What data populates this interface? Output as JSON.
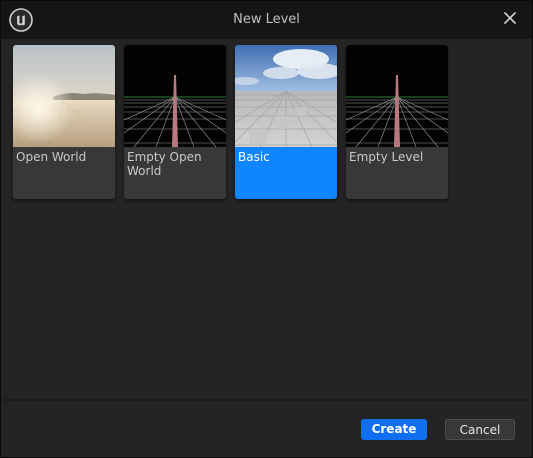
{
  "dialog": {
    "title": "New Level",
    "icons": {
      "logo": "unreal-engine-logo-icon",
      "close": "close-icon"
    }
  },
  "templates": [
    {
      "label": "Open World",
      "selected": false,
      "thumbnail": "desert-sunset"
    },
    {
      "label": "Empty Open World",
      "selected": false,
      "thumbnail": "grid"
    },
    {
      "label": "Basic",
      "selected": true,
      "thumbnail": "sky-floor"
    },
    {
      "label": "Empty Level",
      "selected": false,
      "thumbnail": "grid"
    }
  ],
  "buttons": {
    "create": "Create",
    "cancel": "Cancel"
  },
  "colors": {
    "accent": "#0f86ff",
    "primary_button": "#0f6ff0",
    "background": "#242424",
    "titlebar": "#151515"
  }
}
